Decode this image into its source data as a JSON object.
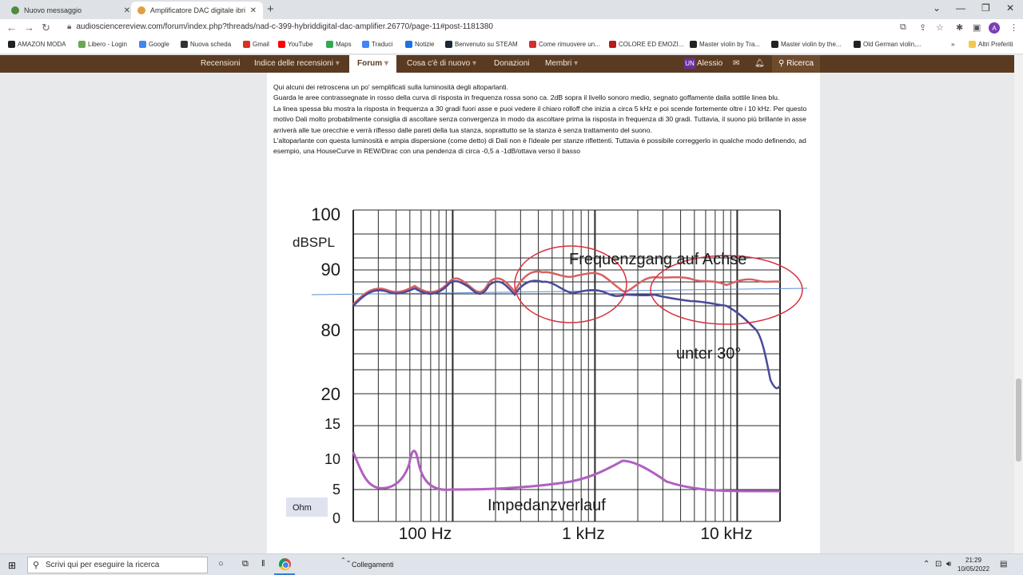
{
  "browser": {
    "tabs": [
      {
        "title": "Nuovo messaggio",
        "active": false,
        "favicon_color": "#4c8c3c"
      },
      {
        "title": "Amplificatore DAC digitale ibrido",
        "active": true,
        "favicon_color": "#e0a040"
      }
    ],
    "new_tab": "+",
    "url": "audiosciencereview.com/forum/index.php?threads/nad-c-399-hybriddigital-dac-amplifier.26770/page-11#post-1181380",
    "avatar_letter": "A",
    "bookmarks": [
      {
        "label": "AMAZON MODA",
        "icon_color": "#222222"
      },
      {
        "label": "Libero - Login",
        "icon_color": "#6aa84f"
      },
      {
        "label": "Google",
        "icon_color": "#4285f4"
      },
      {
        "label": "Nuova scheda",
        "icon_color": "#333333"
      },
      {
        "label": "Gmail",
        "icon_color": "#d93025"
      },
      {
        "label": "YouTube",
        "icon_color": "#ff0000"
      },
      {
        "label": "Maps",
        "icon_color": "#34a853"
      },
      {
        "label": "Traduci",
        "icon_color": "#4285f4"
      },
      {
        "label": "Notizie",
        "icon_color": "#1a73e8"
      },
      {
        "label": "Benvenuto su STEAM",
        "icon_color": "#1b2838"
      },
      {
        "label": "Come rimuovere un...",
        "icon_color": "#d32f2f"
      },
      {
        "label": "COLORE ED EMOZI...",
        "icon_color": "#b71c1c"
      },
      {
        "label": "Master violin by Tra...",
        "icon_color": "#222222"
      },
      {
        "label": "Master violin by the...",
        "icon_color": "#222222"
      },
      {
        "label": "Old German violin,...",
        "icon_color": "#222222"
      }
    ],
    "bookmarks_more": "»",
    "other_bookmarks": "Altri Preferiti"
  },
  "site_nav": {
    "items": [
      {
        "label": "Recensioni",
        "active": false
      },
      {
        "label": "Indice delle recensioni",
        "active": false
      },
      {
        "label": "Forum",
        "active": true
      },
      {
        "label": "Cosa c'è di nuovo",
        "active": false
      },
      {
        "label": "Donazioni",
        "active": false
      },
      {
        "label": "Membri",
        "active": false
      }
    ],
    "user_badge": "UN",
    "user_name": "Alessio",
    "search_label": "Ricerca",
    "bg_color": "#5a3b22"
  },
  "post": {
    "paragraphs": [
      "Qui alcuni dei retroscena un po' semplificati sulla luminosità degli altoparlanti.",
      "Guarda le aree contrassegnate in rosso della curva di risposta in frequenza rossa sono ca. 2dB sopra il livello sonoro medio, segnato goffamente dalla sottile linea blu.",
      "La linea spessa blu mostra la risposta in frequenza a 30 gradi fuori asse e puoi vedere il chiaro rolloff che inizia a circa 5 kHz e poi scende fortemente oltre i 10 kHz. Per questo motivo Dali molto probabilmente consiglia di ascoltare senza convergenza in modo da ascoltare prima la risposta in frequenza di 30 gradi. Tuttavia, il suono più brillante in asse arriverà alle tue orecchie e verrà riflesso dalle pareti della tua stanza, soprattutto se la stanza è senza trattamento del suono.",
      "L'altoparlante con questa luminosità e ampia dispersione (come detto) di Dali non è l'ideale per stanze riflettenti. Tuttavia è possibile correggerlo in qualche modo definendo, ad esempio, una HouseCurve in REW/Dirac con una pendenza di circa -0,5 a -1dB/ottava verso il basso"
    ]
  },
  "chart": {
    "y_unit": "dBSPL",
    "y_labels": [
      "100",
      "90",
      "80",
      "20",
      "15",
      "10",
      "5",
      "0"
    ],
    "x_labels": [
      "100 Hz",
      "1 kHz",
      "10 kHz"
    ],
    "ohm_label": "Ohm",
    "annotation_on_axis": "Frequenzgang auf Achse",
    "annotation_off_axis": "unter 30°",
    "annotation_impedance": "Impedanzverlauf",
    "colors": {
      "on_axis": "#d96060",
      "off_axis": "#4a4a9a",
      "impedance": "#b060c0",
      "reference": "#5a8fd0",
      "circles": "#d83040"
    }
  },
  "taskbar": {
    "search_placeholder": "Scrivi qui per eseguire la ricerca",
    "collegamenti": "Collegamenti",
    "time": "21:29",
    "date": "10/05/2022"
  }
}
